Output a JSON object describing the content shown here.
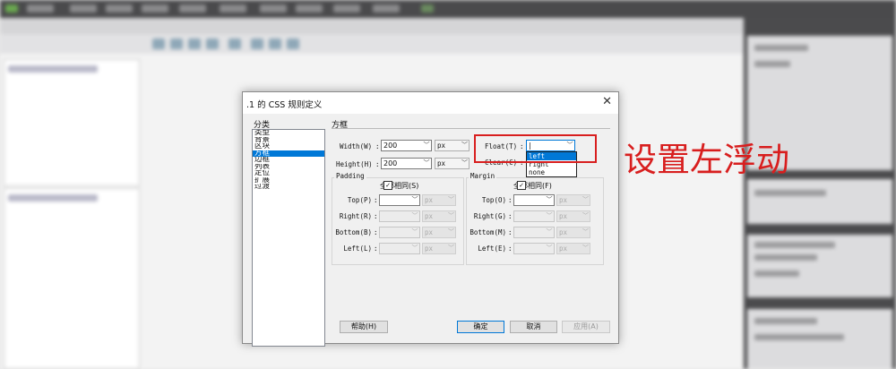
{
  "dialog": {
    "title": ".1 的 CSS 规则定义",
    "close_glyph": "✕",
    "category_label": "分类",
    "categories": [
      {
        "label": "类型",
        "selected": false
      },
      {
        "label": "背景",
        "selected": false
      },
      {
        "label": "区块",
        "selected": false
      },
      {
        "label": "方框",
        "selected": true
      },
      {
        "label": "边框",
        "selected": false
      },
      {
        "label": "列表",
        "selected": false
      },
      {
        "label": "定位",
        "selected": false
      },
      {
        "label": "扩展",
        "selected": false
      },
      {
        "label": "过渡",
        "selected": false
      }
    ],
    "section_title": "方框",
    "width": {
      "label": "Width(W)",
      "value": "200",
      "unit": "px"
    },
    "height": {
      "label": "Height(H)",
      "value": "200",
      "unit": "px"
    },
    "float": {
      "label": "Float(T)",
      "value": "|",
      "options": [
        "left",
        "right",
        "none"
      ],
      "highlighted": "left"
    },
    "clear": {
      "label": "Clear(C)"
    },
    "padding": {
      "title": "Padding",
      "same_label": "全部相同(S)",
      "checked": true,
      "rows": [
        {
          "label": "Top(P)",
          "unit": "px"
        },
        {
          "label": "Right(R)",
          "unit": "px"
        },
        {
          "label": "Bottom(B)",
          "unit": "px"
        },
        {
          "label": "Left(L)",
          "unit": "px"
        }
      ]
    },
    "margin": {
      "title": "Margin",
      "same_label": "全部相同(F)",
      "checked": true,
      "rows": [
        {
          "label": "Top(O)",
          "unit": "px"
        },
        {
          "label": "Right(G)",
          "unit": "px"
        },
        {
          "label": "Bottom(M)",
          "unit": "px"
        },
        {
          "label": "Left(E)",
          "unit": "px"
        }
      ]
    },
    "buttons": {
      "help": "帮助(H)",
      "ok": "确定",
      "cancel": "取消",
      "apply": "应用(A)"
    }
  },
  "annotation": {
    "text": "设置左浮动",
    "color": "#d81e1e"
  },
  "colors": {
    "selection": "#0078d7",
    "dialog_bg": "#f0f0f0"
  }
}
